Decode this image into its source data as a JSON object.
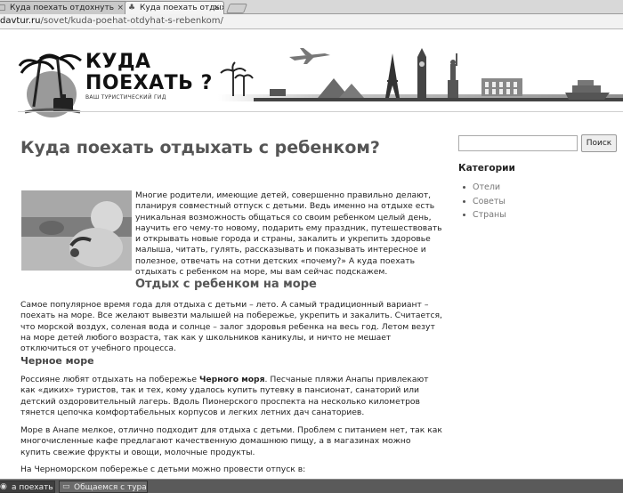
{
  "browser": {
    "tabs": [
      {
        "label": "Куда поехать отдохнуть",
        "icon": "page-icon"
      },
      {
        "label": "Куда поехать отдыхать",
        "icon": "palm-icon"
      }
    ],
    "address": {
      "host": "davtur.ru",
      "path": "/sovet/kuda-poehat-otdyhat-s-rebenkom/"
    }
  },
  "site": {
    "logo_title_line1": "КУДА",
    "logo_title_line2": "ПОЕХАТЬ ?",
    "logo_subtitle": "ВАШ ТУРИСТИЧЕСКИЙ ГИД"
  },
  "article": {
    "title": "Куда поехать отдыхать с ребенком?",
    "intro": "Многие родители, имеющие детей, совершенно правильно делают, планируя совместный отпуск с детьми. Ведь именно на отдыхе есть уникальная возможность общаться со своим ребенком целый день, научить его чему-то новому, подарить ему праздник, путешествовать и открывать новые города и страны, закалить и укрепить здоровье малыша, читать, гулять, рассказывать и показывать интересное и полезное, отвечать на сотни детских «почему?» А куда поехать отдыхать с ребенком на море, мы вам сейчас подскажем.",
    "h2": "Отдых с ребенком на море",
    "p1": "Самое популярное время года для отдыха с детьми – лето. А самый традиционный вариант – поехать на море. Все желают вывезти малышей на побережье, укрепить и закалить. Считается, что морской воздух, соленая вода и солнце – залог здоровья ребенка на весь год. Летом везут на море детей любого возраста, так как у школьников каникулы, и ничто не мешает отключиться от учебного процесса.",
    "h3": "Черное море",
    "p2_before": "Россияне любят отдыхать на побережье ",
    "p2_bold": "Черного моря",
    "p2_after": ". Песчаные пляжи Анапы привлекают как «диких» туристов, так и тех, кому удалось купить путевку в пансионат, санаторий или детский оздоровительный лагерь. Вдоль Пионерского проспекта на несколько километров тянется цепочка комфортабельных корпусов и легких летних дач санаториев.",
    "p3": "Море в Анапе мелкое, отлично подходит для отдыха с детьми. Проблем с питанием нет, так как многочисленные кафе предлагают качественную домашнюю пищу, а в магазинах можно купить свежие фрукты и овощи, молочные продукты.",
    "p4": "На Черноморском побережье с детьми можно провести отпуск в:"
  },
  "sidebar": {
    "search_value": "",
    "search_button": "Поиск",
    "categories_heading": "Категории",
    "categories": [
      "Отели",
      "Советы",
      "Страны"
    ]
  },
  "taskbar": {
    "items": [
      {
        "label": "а поехать отд...",
        "icon": "browser-icon"
      },
      {
        "label": "Общаемся с тура...",
        "icon": "folder-icon"
      }
    ]
  }
}
